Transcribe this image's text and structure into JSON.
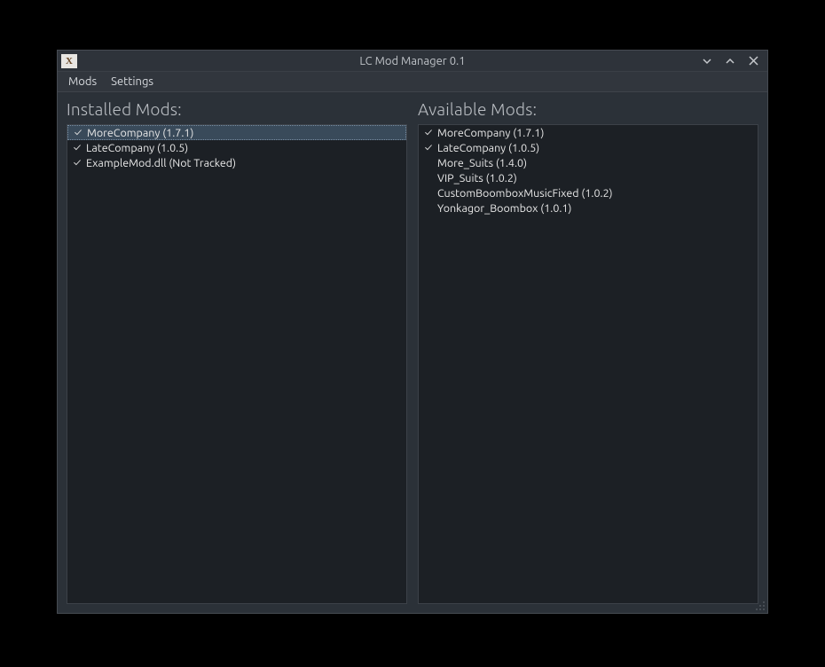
{
  "window": {
    "title": "LC Mod Manager 0.1",
    "app_icon_letter": "X"
  },
  "menubar": {
    "items": [
      {
        "label": "Mods"
      },
      {
        "label": "Settings"
      }
    ]
  },
  "panels": {
    "installed": {
      "title": "Installed Mods:",
      "items": [
        {
          "checked": true,
          "label": "MoreCompany (1.7.1)",
          "selected": true
        },
        {
          "checked": true,
          "label": "LateCompany (1.0.5)",
          "selected": false
        },
        {
          "checked": true,
          "label": "ExampleMod.dll (Not Tracked)",
          "selected": false
        }
      ]
    },
    "available": {
      "title": "Available Mods:",
      "items": [
        {
          "checked": true,
          "label": "MoreCompany (1.7.1)",
          "selected": false
        },
        {
          "checked": true,
          "label": "LateCompany (1.0.5)",
          "selected": false
        },
        {
          "checked": false,
          "label": "More_Suits (1.4.0)",
          "selected": false
        },
        {
          "checked": false,
          "label": "VIP_Suits (1.0.2)",
          "selected": false
        },
        {
          "checked": false,
          "label": "CustomBoomboxMusicFixed (1.0.2)",
          "selected": false
        },
        {
          "checked": false,
          "label": "Yonkagor_Boombox (1.0.1)",
          "selected": false
        }
      ]
    }
  }
}
